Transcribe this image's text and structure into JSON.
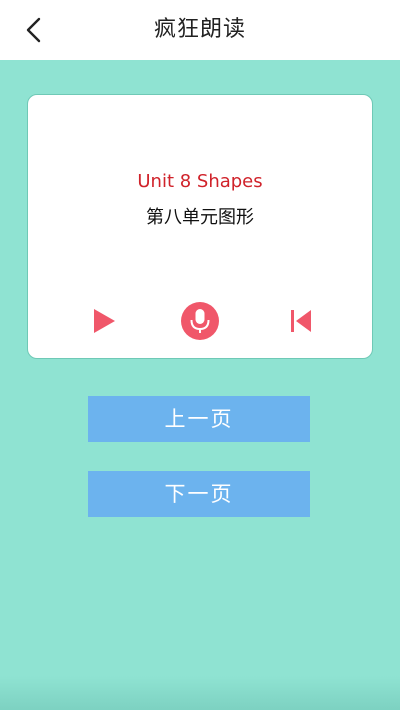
{
  "header": {
    "title": "疯狂朗读",
    "back_icon": "chevron-left-icon"
  },
  "card": {
    "title_en": "Unit 8 Shapes",
    "title_zh": "第八单元图形",
    "controls": {
      "play_icon": "play-icon",
      "mic_icon": "microphone-icon",
      "restart_icon": "skip-back-icon"
    }
  },
  "buttons": {
    "prev_label": "上一页",
    "next_label": "下一页"
  },
  "colors": {
    "background": "#8fe3d2",
    "accent_red": "#d0222a",
    "icon_pink": "#f0576a",
    "button_blue": "#6cb3ee"
  }
}
